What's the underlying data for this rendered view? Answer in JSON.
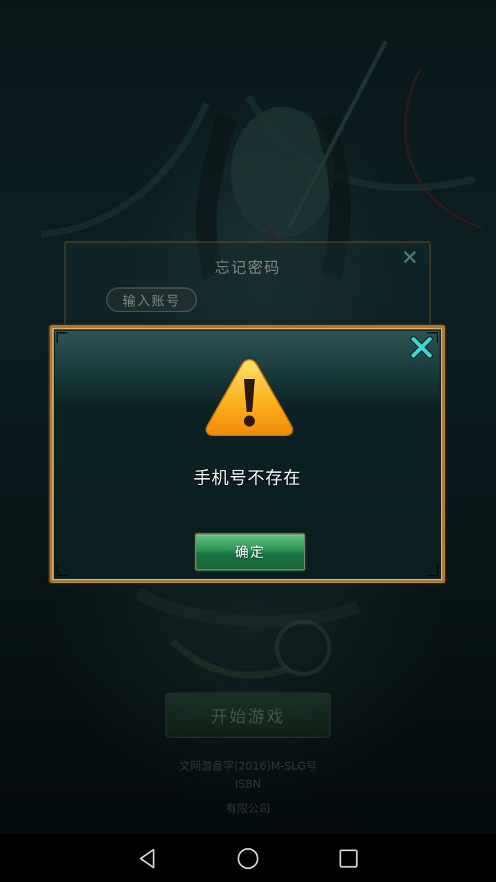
{
  "background_screen": {
    "forgot_password_panel": {
      "title": "忘记密码",
      "account_pill_label": "输入账号",
      "close_icon": "close-icon"
    },
    "start_button_label": "开始游戏",
    "legal_lines": [
      "文网游备字(2016)M-SLG号",
      "ISBN",
      "有限公司"
    ]
  },
  "dialog": {
    "icon": "warning-icon",
    "message": "手机号不存在",
    "confirm_label": "确定",
    "close_icon": "close-icon",
    "colors": {
      "frame": "#a87a3d",
      "close": "#40d6d0",
      "confirm": "#2e9355",
      "warning": "#f7a21a"
    }
  },
  "navbar": {
    "back": "back-icon",
    "home": "home-icon",
    "recents": "recents-icon"
  }
}
